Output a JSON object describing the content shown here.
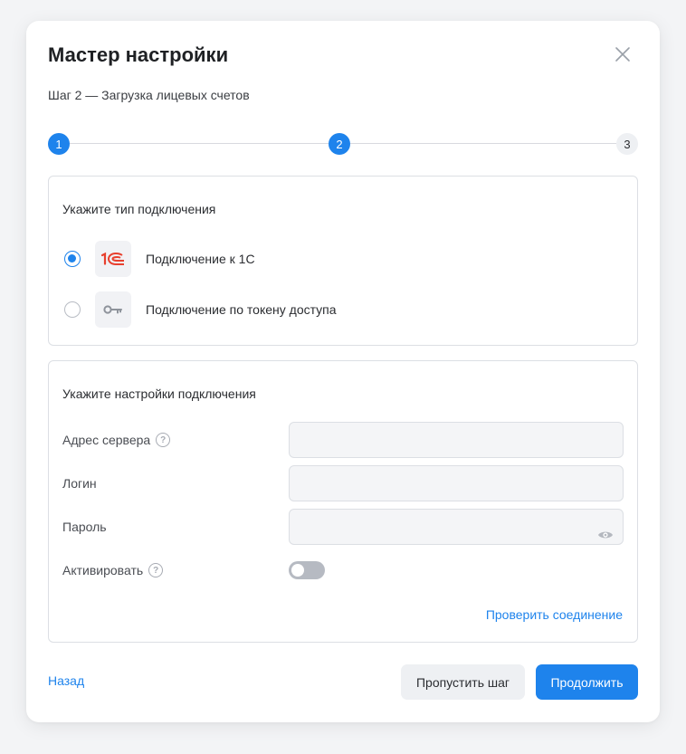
{
  "wizard": {
    "title": "Мастер настройки",
    "subtitle": "Шаг 2 — Загрузка лицевых счетов",
    "steps": [
      {
        "label": "1",
        "state": "active"
      },
      {
        "label": "2",
        "state": "active"
      },
      {
        "label": "3",
        "state": "inactive"
      }
    ]
  },
  "connection_type": {
    "title": "Укажите тип подключения",
    "options": [
      {
        "label": "Подключение к 1С",
        "icon": "1c-logo-icon",
        "selected": true
      },
      {
        "label": "Подключение по токену доступа",
        "icon": "key-icon",
        "selected": false
      }
    ]
  },
  "connection_settings": {
    "title": "Укажите настройки подключения",
    "server_label": "Адрес сервера",
    "server_value": "",
    "login_label": "Логин",
    "login_value": "",
    "password_label": "Пароль",
    "password_value": "",
    "activate_label": "Активировать",
    "activate_on": false,
    "help_glyph": "?",
    "check_link": "Проверить соединение"
  },
  "footer": {
    "back": "Назад",
    "skip": "Пропустить шаг",
    "next": "Продолжить"
  },
  "colors": {
    "accent": "#1e83ec",
    "brand_1c": "#e8402e"
  }
}
